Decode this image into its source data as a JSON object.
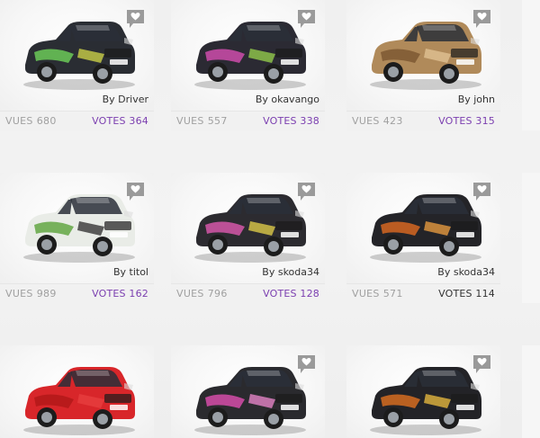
{
  "labels": {
    "views": "VUES",
    "votes": "VOTES",
    "by": "By"
  },
  "cards": [
    {
      "views": "680",
      "votes": "364",
      "author": "Driver",
      "votes_color": "purple",
      "show_comment": true,
      "body_color": "#2a2d33",
      "accent1": "#6fd35a",
      "accent2": "#d4d94a"
    },
    {
      "views": "557",
      "votes": "338",
      "author": "okavango",
      "votes_color": "purple",
      "show_comment": true,
      "body_color": "#2b2a33",
      "accent1": "#d84fb3",
      "accent2": "#9ad44e"
    },
    {
      "views": "423",
      "votes": "315",
      "author": "john",
      "votes_color": "purple",
      "show_comment": true,
      "body_color": "#b08a5a",
      "accent1": "#7a5530",
      "accent2": "#e3c497"
    },
    {
      "views": "989",
      "votes": "162",
      "author": "titol",
      "votes_color": "purple",
      "show_comment": true,
      "body_color": "#e9ece7",
      "accent1": "#5aa23a",
      "accent2": "#2a2a2a"
    },
    {
      "views": "796",
      "votes": "128",
      "author": "skoda34",
      "votes_color": "purple",
      "show_comment": true,
      "body_color": "#2c2b30",
      "accent1": "#e05ab0",
      "accent2": "#e7d44a"
    },
    {
      "views": "571",
      "votes": "114",
      "author": "skoda34",
      "votes_color": "dark",
      "show_comment": true,
      "body_color": "#242428",
      "accent1": "#e06a20",
      "accent2": "#f0a040"
    },
    {
      "views": "",
      "votes": "",
      "author": "",
      "votes_color": "purple",
      "show_comment": false,
      "body_color": "#d8262a",
      "accent1": "#b01818",
      "accent2": "#e84040"
    },
    {
      "views": "",
      "votes": "",
      "author": "",
      "votes_color": "purple",
      "show_comment": true,
      "body_color": "#2a2a2e",
      "accent1": "#e04fb0",
      "accent2": "#f08ad0"
    },
    {
      "views": "",
      "votes": "",
      "author": "",
      "votes_color": "purple",
      "show_comment": true,
      "body_color": "#232327",
      "accent1": "#e07020",
      "accent2": "#f0c040"
    }
  ]
}
